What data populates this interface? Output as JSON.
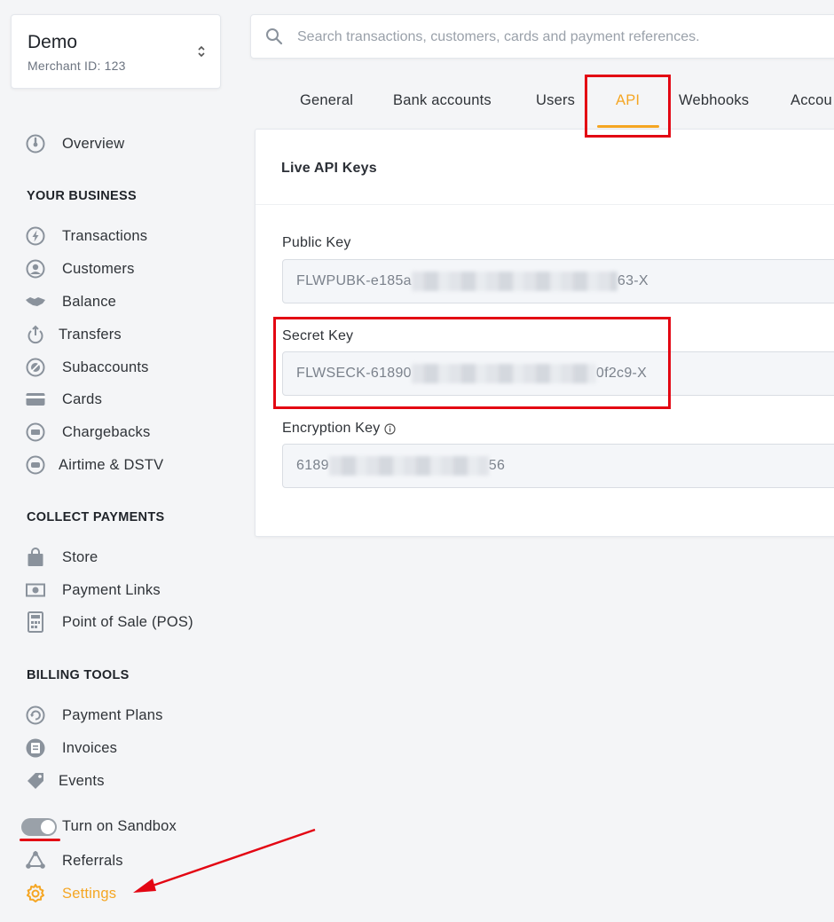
{
  "merchant": {
    "name": "Demo",
    "merchant_id": "Merchant ID: 123"
  },
  "search": {
    "placeholder": "Search transactions, customers, cards and payment references."
  },
  "sidebar": {
    "overview": "Overview",
    "sections": {
      "business": "YOUR BUSINESS",
      "collect": "COLLECT PAYMENTS",
      "billing": "BILLING TOOLS"
    },
    "business_items": [
      "Transactions",
      "Customers",
      "Balance",
      "Transfers",
      "Subaccounts",
      "Cards",
      "Chargebacks",
      "Airtime & DSTV"
    ],
    "collect_items": [
      "Store",
      "Payment Links",
      "Point of Sale (POS)"
    ],
    "billing_items": [
      "Payment Plans",
      "Invoices",
      "Events"
    ],
    "sandbox_label": "Turn on Sandbox",
    "referrals": "Referrals",
    "settings": "Settings"
  },
  "tabs": [
    "General",
    "Bank accounts",
    "Users",
    "API",
    "Webhooks",
    "Accou"
  ],
  "active_tab": "API",
  "card": {
    "title": "Live API Keys",
    "public_key": {
      "label": "Public Key",
      "prefix": "FLWPUBK-e185a",
      "suffix": "63-X"
    },
    "secret_key": {
      "label": "Secret Key",
      "prefix": "FLWSECK-61890",
      "suffix": "0f2c9-X"
    },
    "encryption_key": {
      "label": "Encryption Key",
      "prefix": "6189",
      "suffix": "56"
    }
  },
  "colors": {
    "accent": "#f5a623",
    "annotation": "#e30613",
    "toggle": "#9aa1a9"
  }
}
